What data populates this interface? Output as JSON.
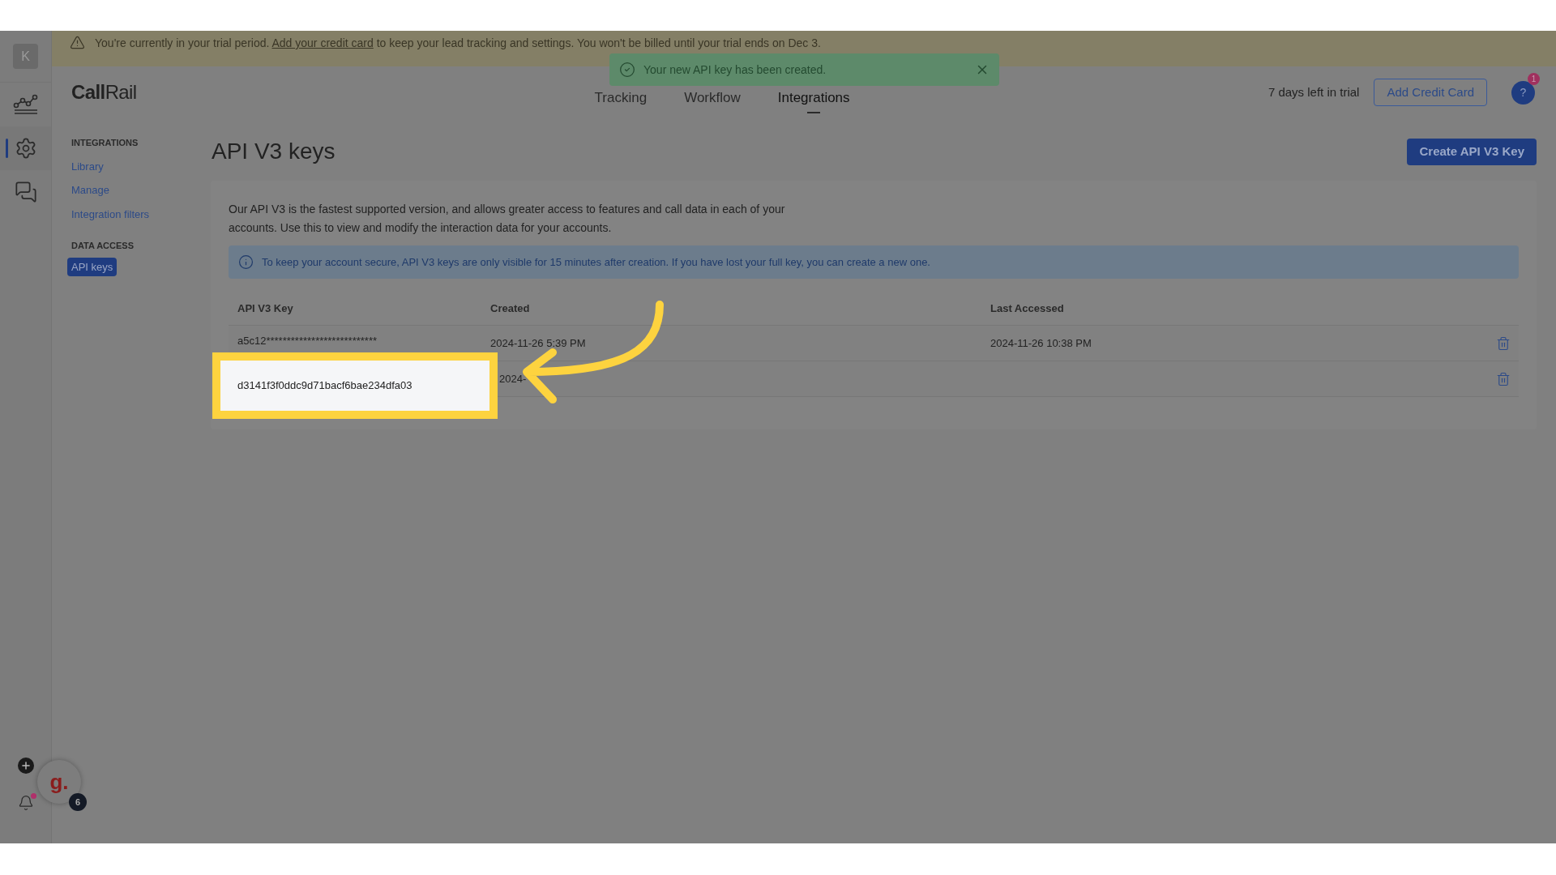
{
  "banner": {
    "before": "You're currently in your trial period. ",
    "link": "Add your credit card",
    "after": " to keep your lead tracking and settings. You won't be billed until your trial ends on Dec 3."
  },
  "toast": {
    "message": "Your new API key has been created."
  },
  "rail": {
    "avatar": "K",
    "items": [
      {
        "kind": "reports",
        "selected": false
      },
      {
        "kind": "settings",
        "selected": true
      },
      {
        "kind": "messages",
        "selected": false
      }
    ]
  },
  "header": {
    "logo": "CallRail",
    "nav": [
      {
        "label": "Tracking",
        "selected": false
      },
      {
        "label": "Workflow",
        "selected": false
      },
      {
        "label": "Integrations",
        "selected": true
      }
    ],
    "trial": "7 days left in trial",
    "add_card": "Add Credit Card",
    "help": "?",
    "help_badge": "1"
  },
  "sidenav": [
    {
      "heading": "INTEGRATIONS",
      "items": [
        {
          "label": "Library",
          "selected": false
        },
        {
          "label": "Manage",
          "selected": false
        },
        {
          "label": "Integration filters",
          "selected": false
        }
      ]
    },
    {
      "heading": "DATA ACCESS",
      "items": [
        {
          "label": "API keys",
          "selected": true
        }
      ]
    }
  ],
  "page": {
    "title": "API V3 keys",
    "create_button": "Create API V3 Key",
    "description": "Our API V3 is the fastest supported version, and allows greater access to features and call data in each of your accounts. Use this to view and modify the interaction data for your accounts.",
    "info": "To keep your account secure, API V3 keys are only visible for 15 minutes after creation. If you have lost your full key, you can create a new one.",
    "table": {
      "columns": [
        "API V3 Key",
        "Created",
        "Last Accessed"
      ],
      "rows": [
        {
          "key": "a5c12***************************",
          "created": "2024-11-26 5:39 PM",
          "last_accessed": "2024-11-26 10:38 PM",
          "highlighted": false
        },
        {
          "key": "d3141f3f0ddc9d71bacf6bae234dfa03",
          "created": "2024-",
          "highlighted": true
        }
      ]
    }
  },
  "widget": {
    "label": "g.",
    "badge": "6"
  }
}
